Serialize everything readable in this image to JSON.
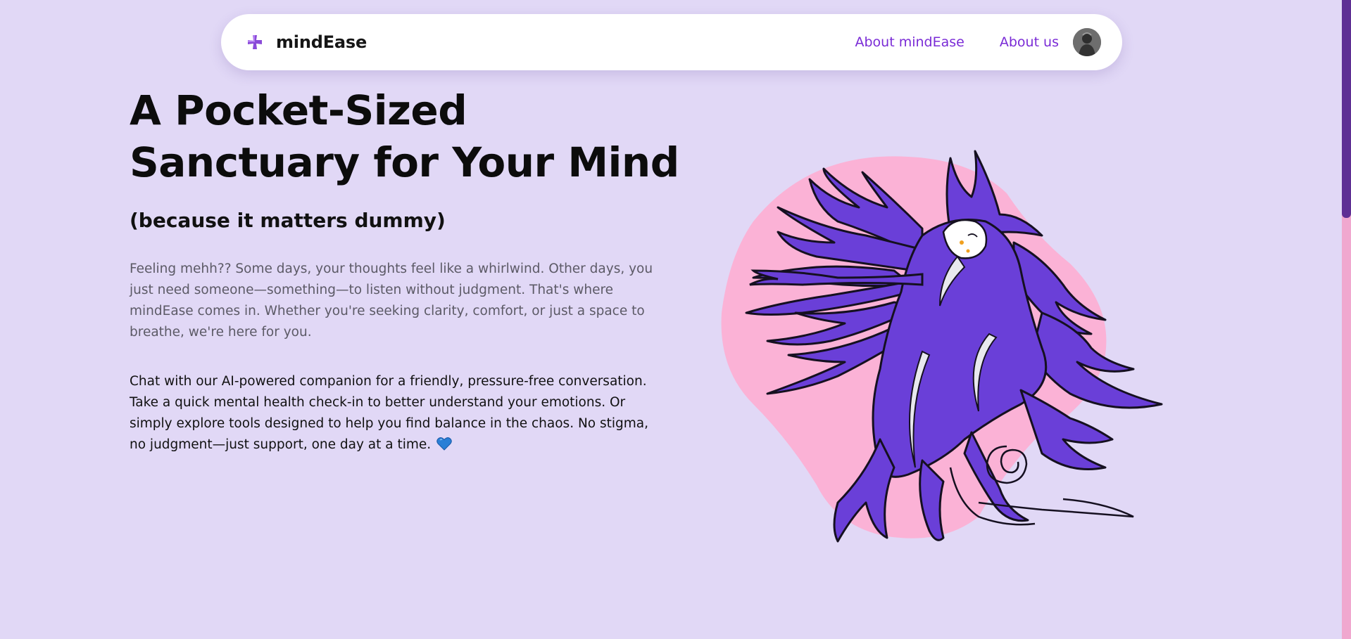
{
  "nav": {
    "brand": "mindEase",
    "links": [
      "About mindEase",
      "About us"
    ]
  },
  "hero": {
    "title_line1": "A Pocket-Sized",
    "title_line2": "Sanctuary for Your Mind",
    "subtitle": "(because it matters dummy)",
    "intro": "Feeling mehh?? Some days, your thoughts feel like a whirlwind. Other days, you just need someone—something—to listen without judgment. That's where mindEase comes in. Whether you're seeking clarity, comfort, or just a space to breathe, we're here for you.",
    "body": "Chat with our AI-powered companion for a friendly, pressure-free conversation. Take a quick mental health check-in to better understand your emotions. Or simply explore tools designed to help you find balance in the chaos. No stigma, no judgment—just support, one day at a time."
  },
  "icons": {
    "brand": "plus-cross-icon",
    "avatar": "user-avatar",
    "heart": "blue-heart-icon",
    "illustration": "flowing-hair-woman-illustration"
  },
  "colors": {
    "background": "#e1d8f6",
    "accent": "#7a2bd6",
    "figure": "#6a3fd8",
    "blob": "#fbb2d6",
    "scroll_thumb": "#5e2f94"
  }
}
